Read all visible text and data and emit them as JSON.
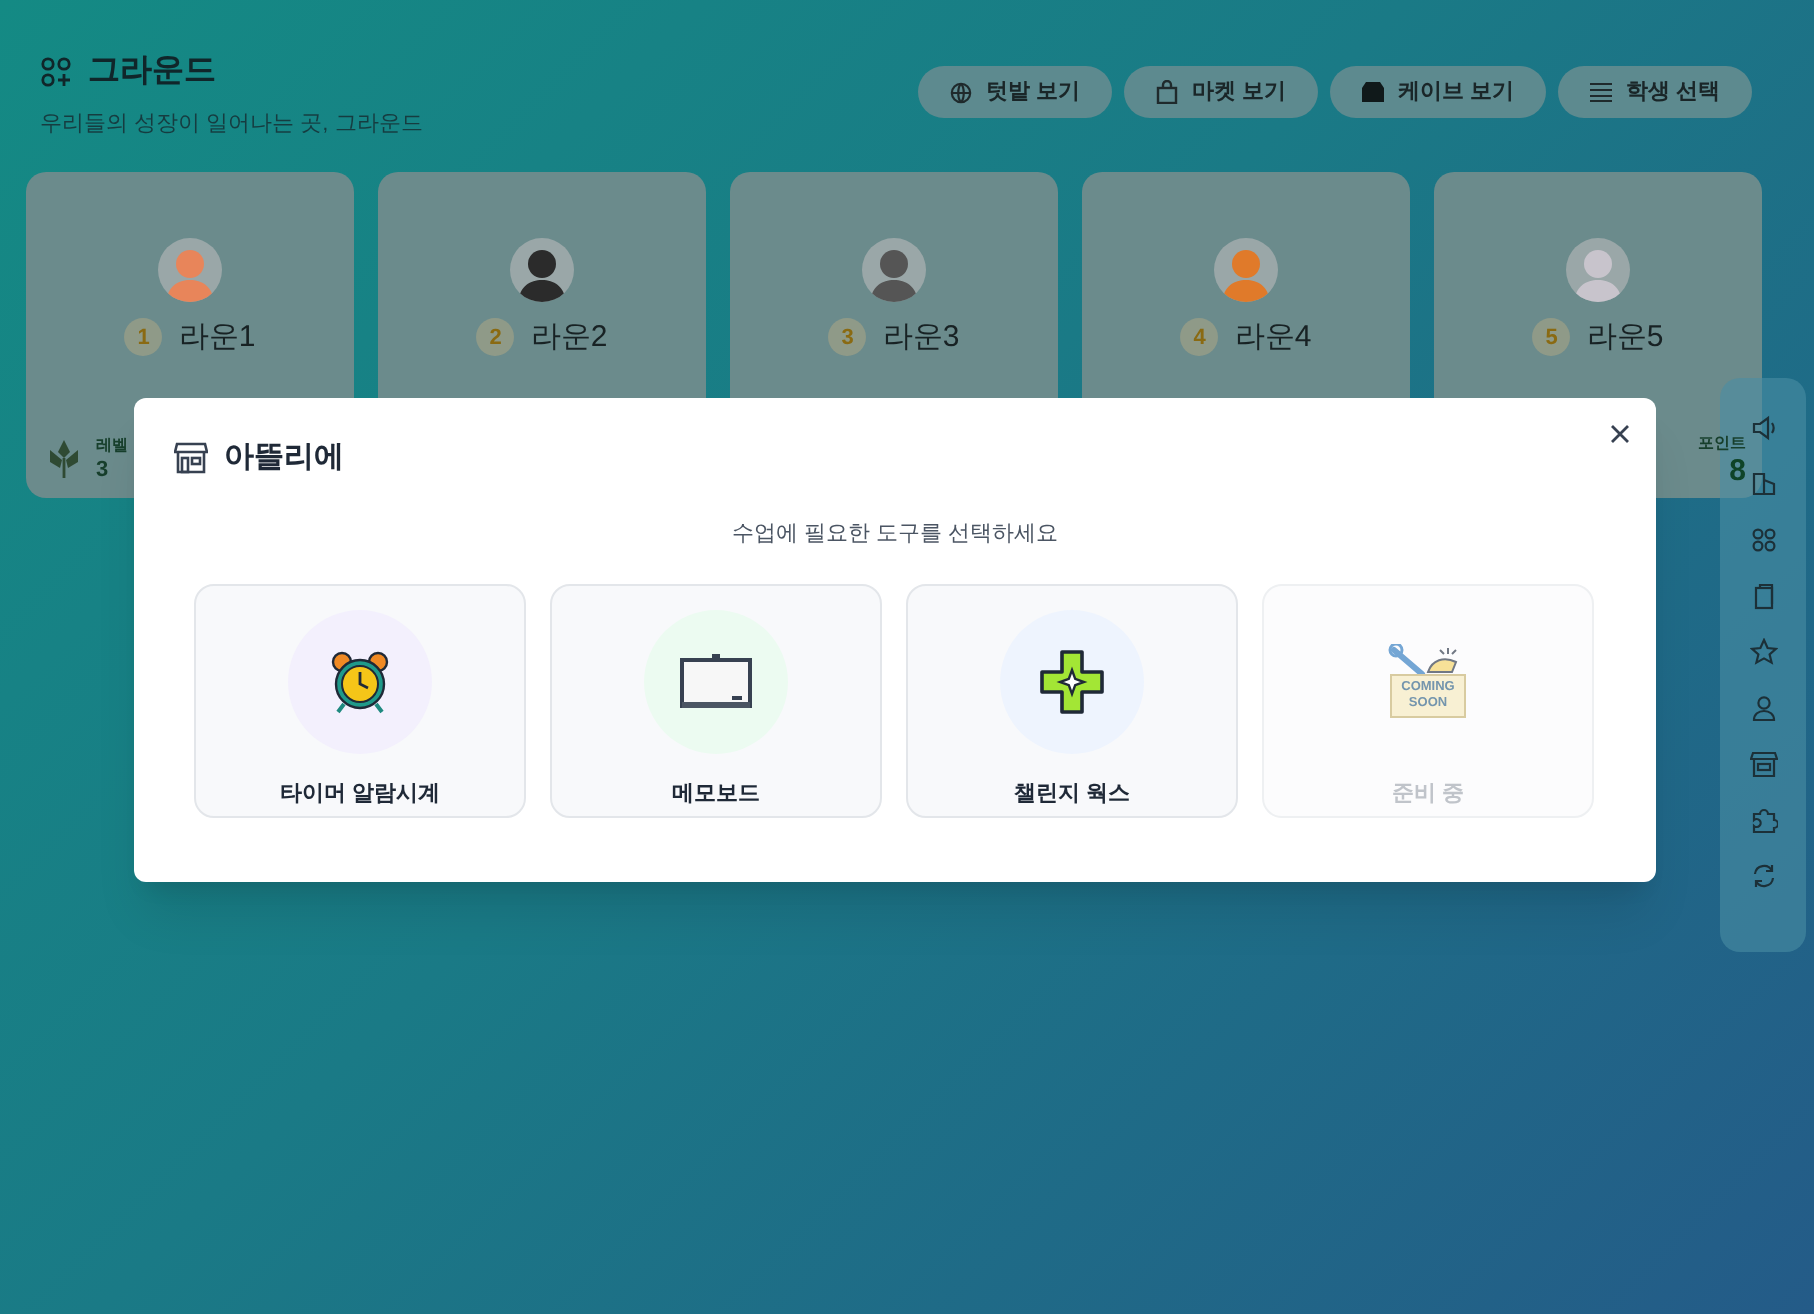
{
  "header": {
    "title": "그라운드",
    "subtitle": "우리들의 성장이 일어나는 곳, 그라운드"
  },
  "nav_buttons": [
    {
      "label": "텃밭 보기",
      "kind": "garden"
    },
    {
      "label": "마켓 보기",
      "kind": "market"
    },
    {
      "label": "케이브 보기",
      "kind": "cave"
    },
    {
      "label": "학생 선택",
      "kind": "list"
    }
  ],
  "students": [
    {
      "rank": "1",
      "name": "라운1",
      "color": "#e8855a",
      "stat": {
        "kind": "level",
        "label": "레벨",
        "value": "3"
      }
    },
    {
      "rank": "2",
      "name": "라운2",
      "color": "#2b2b2b"
    },
    {
      "rank": "3",
      "name": "라운3",
      "color": "#555555"
    },
    {
      "rank": "4",
      "name": "라운4",
      "color": "#e07a2a"
    },
    {
      "rank": "5",
      "name": "라운5",
      "color": "#c8c4cc",
      "stat": {
        "kind": "points",
        "label": "포인트",
        "value": "8"
      }
    }
  ],
  "modal": {
    "title": "아뜰리에",
    "subtitle": "수업에 필요한 도구를 선택하세요",
    "tools": [
      {
        "label": "타이머 알람시계",
        "kind": "timer",
        "disabled": false
      },
      {
        "label": "메모보드",
        "kind": "memo",
        "disabled": false
      },
      {
        "label": "챌린지 웍스",
        "kind": "challenge",
        "disabled": false
      },
      {
        "label": "준비 중",
        "kind": "coming_soon",
        "disabled": true,
        "badge_lines": [
          "COMING",
          "SOON"
        ]
      }
    ]
  }
}
